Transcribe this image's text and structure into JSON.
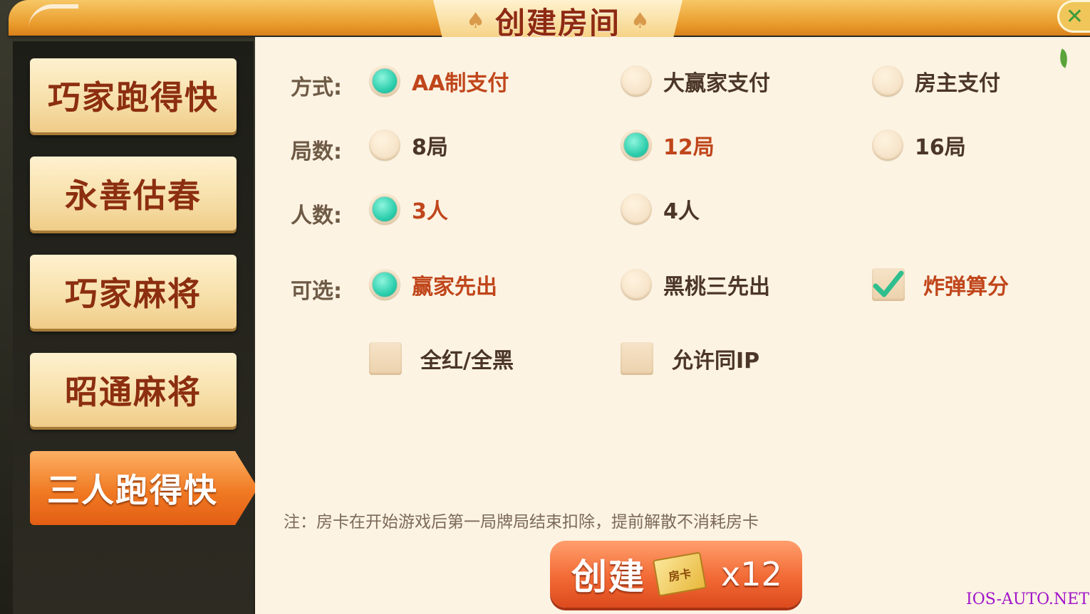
{
  "dialog": {
    "title": "创建房间",
    "spade_symbol": "♠",
    "close_symbol": "✕"
  },
  "sidebar": {
    "games": [
      {
        "label": "巧家跑得快",
        "active": false
      },
      {
        "label": "永善估春",
        "active": false
      },
      {
        "label": "巧家麻将",
        "active": false
      },
      {
        "label": "昭通麻将",
        "active": false
      },
      {
        "label": "三人跑得快",
        "active": true
      }
    ]
  },
  "options": {
    "payment": {
      "label": "方式:",
      "choices": [
        {
          "label": "AA制支付",
          "selected": true
        },
        {
          "label": "大赢家支付",
          "selected": false
        },
        {
          "label": "房主支付",
          "selected": false
        }
      ]
    },
    "rounds": {
      "label": "局数:",
      "choices": [
        {
          "label": "8局",
          "selected": false
        },
        {
          "label": "12局",
          "selected": true
        },
        {
          "label": "16局",
          "selected": false
        }
      ]
    },
    "players": {
      "label": "人数:",
      "choices": [
        {
          "label": "3人",
          "selected": true
        },
        {
          "label": "4人",
          "selected": false
        }
      ]
    },
    "optional": {
      "label": "可选:",
      "choices": [
        {
          "label": "赢家先出",
          "selected": true
        },
        {
          "label": "黑桃三先出",
          "selected": false
        },
        {
          "label": "炸弹算分",
          "checked": true
        },
        {
          "label": "全红/全黑",
          "checked": false
        },
        {
          "label": "允许同IP",
          "checked": false
        }
      ]
    }
  },
  "note": "注：房卡在开始游戏后第一局牌局结束扣除，提前解散不消耗房卡",
  "create_button": {
    "label": "创建",
    "card_label": "房卡",
    "count": "x12"
  },
  "watermark": "IOS-AUTO.NET",
  "colors": {
    "accent_orange": "#f07a23",
    "selected_radio": "#2ecfae",
    "selected_text": "#c0461b",
    "panel_bg": "#fcf3e3"
  }
}
